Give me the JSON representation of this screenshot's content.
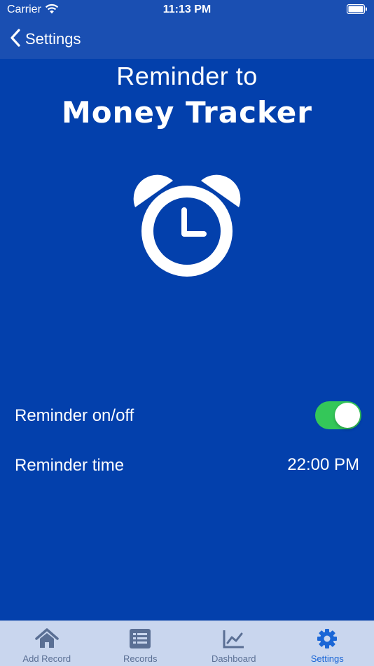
{
  "status_bar": {
    "carrier": "Carrier",
    "time": "11:13 PM"
  },
  "nav": {
    "back_label": "Settings"
  },
  "header": {
    "line1": "Reminder to",
    "line2": "Money Tracker"
  },
  "settings": {
    "reminder_toggle_label": "Reminder on/off",
    "reminder_enabled": true,
    "reminder_time_label": "Reminder time",
    "reminder_time_value": "22:00 PM"
  },
  "tabs": [
    {
      "label": "Add Record",
      "icon": "home-icon",
      "active": false
    },
    {
      "label": "Records",
      "icon": "list-icon",
      "active": false
    },
    {
      "label": "Dashboard",
      "icon": "chart-icon",
      "active": false
    },
    {
      "label": "Settings",
      "icon": "gear-icon",
      "active": true
    }
  ],
  "colors": {
    "background": "#0340ac",
    "nav_bar": "#1a4fb2",
    "toggle_on": "#34c759",
    "tab_bar": "#c9d6ee",
    "tab_active": "#1a66d6",
    "tab_inactive": "#5a6f94"
  }
}
